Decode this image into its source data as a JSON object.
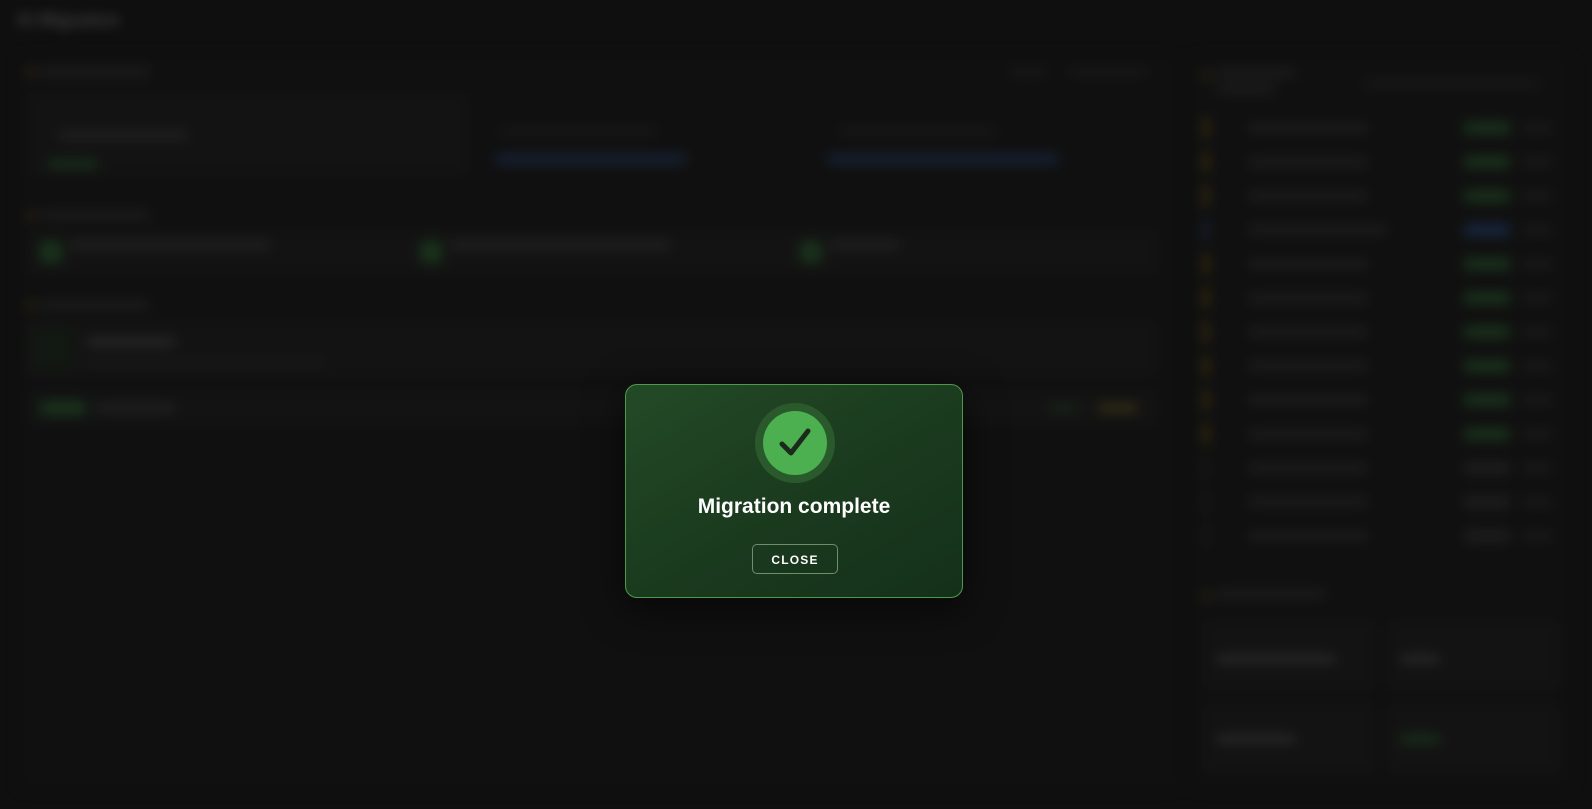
{
  "background": {
    "app_title": "AI Migration"
  },
  "modal": {
    "icon": "checkmark-icon",
    "title": "Migration complete",
    "close_label": "CLOSE",
    "accent_color": "#4caf50",
    "border_color": "#4f9a4a"
  }
}
